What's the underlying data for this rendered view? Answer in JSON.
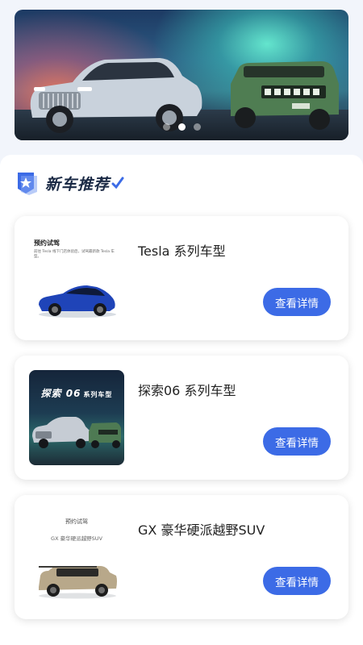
{
  "banner": {
    "slide_count": 3,
    "active_slide": 1
  },
  "section": {
    "title": "新车推荐"
  },
  "cards": [
    {
      "title": "Tesla 系列车型",
      "button_label": "查看详情",
      "thumb_title": "预约试驾",
      "thumb_subtitle": "前往 Tesla 线下门店体验后，试驾最新款 Tesla 车型。"
    },
    {
      "title": "探索06 系列车型",
      "button_label": "查看详情",
      "thumb_title": "探索 06",
      "thumb_suffix": "系列车型"
    },
    {
      "title": "GX 豪华硬派越野SUV",
      "button_label": "查看详情",
      "thumb_title": "预约试驾",
      "thumb_subtitle": "GX 豪华硬派越野SUV"
    }
  ],
  "colors": {
    "accent": "#3c6be6",
    "page_bg": "#f2f5fb"
  }
}
